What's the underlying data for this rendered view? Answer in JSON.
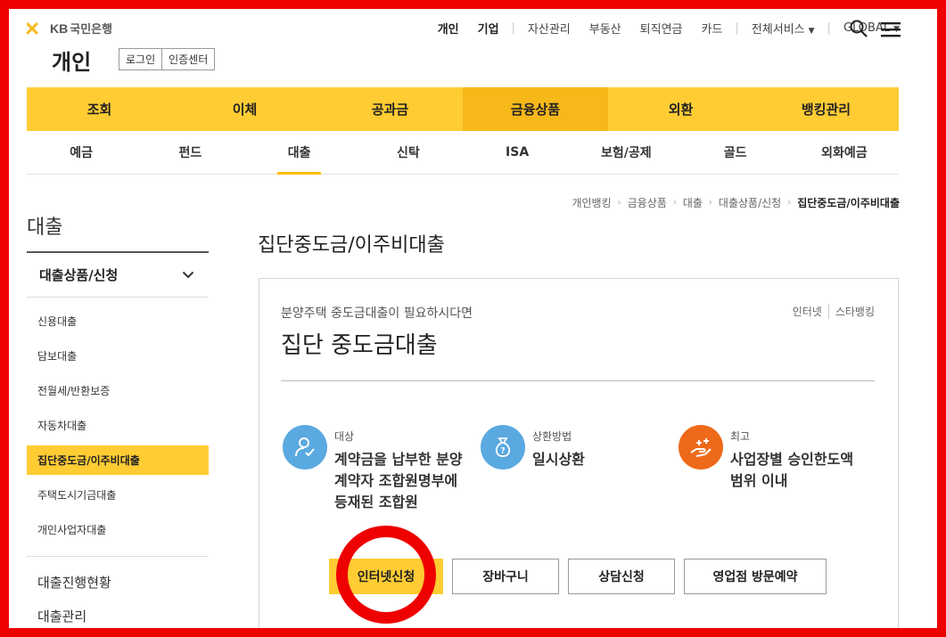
{
  "logo": {
    "kb": "KB",
    "name": "국민은행"
  },
  "section_title": "개인",
  "auth": {
    "login": "로그인",
    "cert": "인증센터"
  },
  "gnb": {
    "items": [
      "개인",
      "기업",
      "자산관리",
      "부동산",
      "퇴직연금",
      "카드",
      "전체서비스",
      "GLOBAL"
    ]
  },
  "main_nav": [
    "조회",
    "이체",
    "공과금",
    "금융상품",
    "외환",
    "뱅킹관리"
  ],
  "sub_nav": [
    "예금",
    "펀드",
    "대출",
    "신탁",
    "ISA",
    "보험/공제",
    "골드",
    "외화예금"
  ],
  "breadcrumb": [
    "개인뱅킹",
    "금융상품",
    "대출",
    "대출상품/신청",
    "집단중도금/이주비대출"
  ],
  "sidebar": {
    "title": "대출",
    "group": "대출상품/신청",
    "items": [
      "신용대출",
      "담보대출",
      "전월세/반환보증",
      "자동차대출",
      "집단중도금/이주비대출",
      "주택도시기금대출",
      "개인사업자대출"
    ],
    "extra": [
      "대출진행현황",
      "대출관리"
    ]
  },
  "page_title": "집단중도금/이주비대출",
  "card": {
    "subtitle": "분양주택 중도금대출이 필요하시다면",
    "title": "집단 중도금대출",
    "tags": [
      "인터넷",
      "스타뱅킹"
    ],
    "features": [
      {
        "label": "대상",
        "lines": [
          "계약금을 납부한 분양",
          "계약자 조합원명부에",
          "등재된 조합원"
        ]
      },
      {
        "label": "상환방법",
        "lines": [
          "일시상환"
        ]
      },
      {
        "label": "최고",
        "lines": [
          "사업장별 승인한도액",
          "범위 이내"
        ]
      }
    ],
    "buttons": {
      "apply": "인터넷신청",
      "cart": "장바구니",
      "consult": "상담신청",
      "visit": "영업점 방문예약"
    }
  },
  "colors": {
    "brand_yellow": "#ffcc33",
    "active_yellow": "#f7b81a",
    "annotation_red": "#ee0000",
    "feature_blue": "#5aa9e0",
    "feature_orange": "#ee6a1a"
  }
}
